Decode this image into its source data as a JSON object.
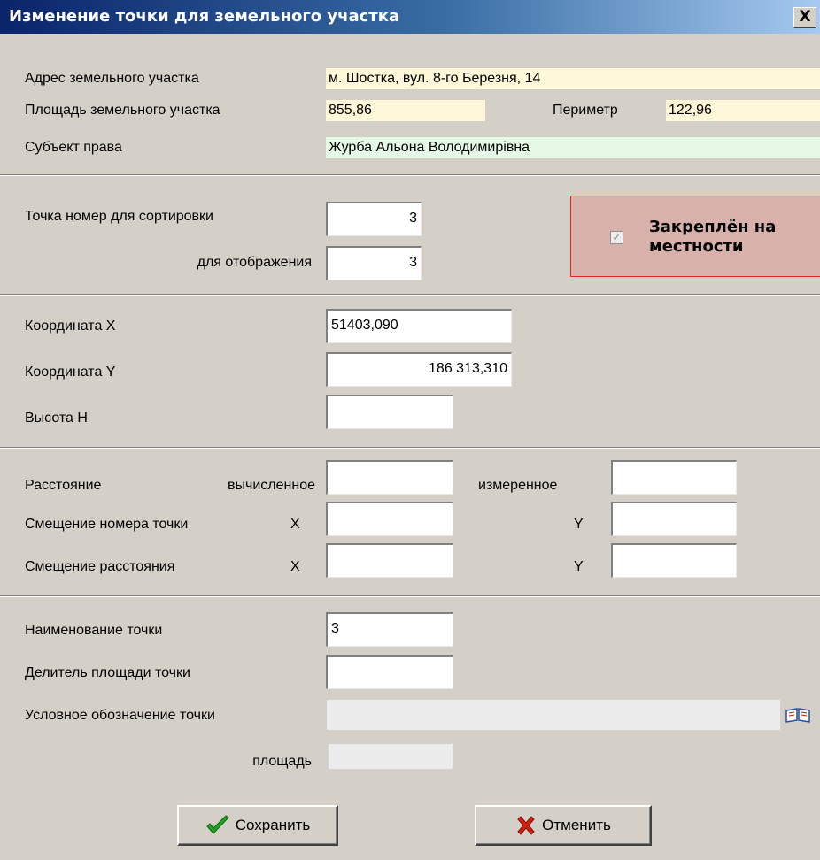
{
  "window": {
    "title": "Изменение точки для земельного участка",
    "close_glyph": "X"
  },
  "parcel": {
    "address_label": "Адрес земельного участка",
    "address_value": "м. Шостка, вул. 8-го Березня, 14",
    "area_label": "Площадь земельного участка",
    "area_value": "855,86",
    "perimeter_label": "Периметр",
    "perimeter_value": "122,96",
    "subject_label": "Субъект права",
    "subject_value": "Журба Альона Володимирівна"
  },
  "point_number": {
    "sort_label": "Точка номер для сортировки",
    "sort_value": "3",
    "display_label": "для отображения",
    "display_value": "3",
    "fixed_label_line1": "Закреплён на",
    "fixed_label_line2": "местности",
    "fixed_checked": true
  },
  "coordinates": {
    "x_label": "Координата X",
    "x_value": "51403,090",
    "y_label": "Координата Y",
    "y_value": "186 313,310",
    "h_label": "Высота Н",
    "h_value": ""
  },
  "offsets": {
    "distance_label": "Расстояние",
    "computed_label": "вычисленное",
    "measured_label": "измеренное",
    "point_offset_label": "Смещение номера точки",
    "distance_offset_label": "Смещение расстояния",
    "x_axis": "X",
    "y_axis": "Y"
  },
  "point_info": {
    "name_label": "Наименование точки",
    "name_value": "3",
    "divisor_label": "Делитель площади точки",
    "symbol_label": "Условное обозначение точки",
    "area_label": "площадь"
  },
  "buttons": {
    "save_label": "Сохранить",
    "cancel_label": "Отменить"
  },
  "colors": {
    "title_start": "#0a246a",
    "title_end": "#a6caf0",
    "readonly_yellow": "#fff8d8",
    "readonly_green": "#e6f8e6",
    "fixed_panel_bg": "#d8b2aa",
    "fixed_panel_border": "#e0281e",
    "save_check": "#22a022",
    "cancel_cross": "#d02010"
  }
}
